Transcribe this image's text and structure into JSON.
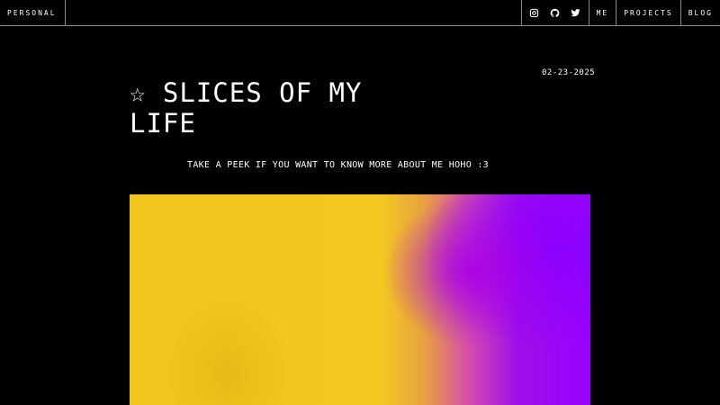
{
  "nav": {
    "brand": "PERSONAL",
    "social_icons": [
      "instagram-icon",
      "github-icon",
      "twitter-icon"
    ],
    "links": [
      "ME",
      "PROJECTS",
      "BLOG"
    ]
  },
  "post": {
    "date": "02-23-2025",
    "title": "☆ SLICES OF MY LIFE",
    "subtitle": "TAKE A PEEK IF YOU WANT TO KNOW MORE ABOUT ME HOHO :3"
  },
  "colors": {
    "background": "#000000",
    "text": "#ffffff",
    "divider": "#8a8a8a",
    "hero_yellow": "#f2c51c",
    "hero_purple": "#9a00ff"
  }
}
